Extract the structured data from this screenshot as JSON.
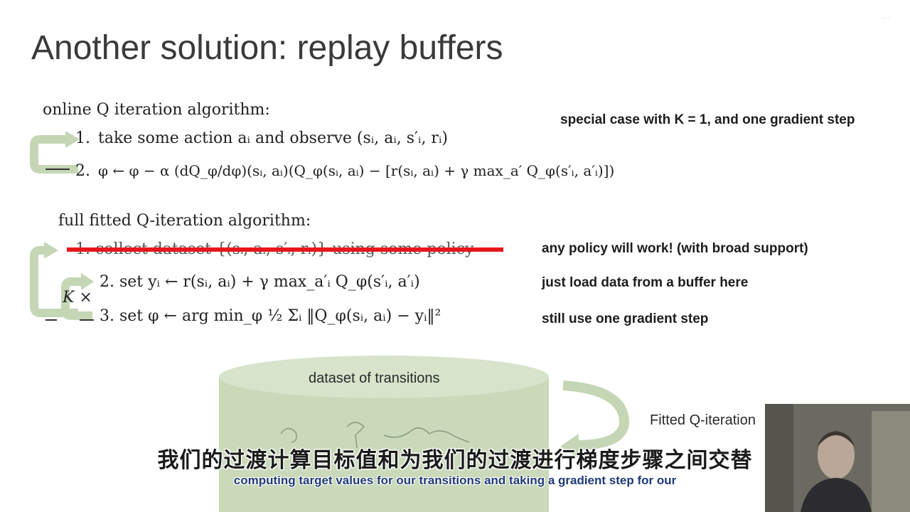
{
  "slide": {
    "title": "Another solution: replay buffers",
    "watermark": "…"
  },
  "online": {
    "heading": "online Q iteration algorithm:",
    "step1_num": "1.",
    "step1": "take some action aᵢ and observe (sᵢ, aᵢ, s′ᵢ, rᵢ)",
    "step2_num": "2.",
    "step2": "φ ← φ − α (dQ_φ/dφ)(sᵢ, aᵢ)(Q_φ(sᵢ, aᵢ) − [r(sᵢ, aᵢ) + γ max_a′ Q_φ(s′ᵢ, a′ᵢ)])",
    "note": "special case with K = 1, and one gradient step"
  },
  "fitted": {
    "heading": "full fitted Q-iteration algorithm:",
    "step1": "1. collect dataset {(sᵢ, aᵢ, s′ᵢ, rᵢ)} using some policy",
    "step2": "2. set yᵢ ← r(sᵢ, aᵢ) + γ max_a′ᵢ Q_φ(s′ᵢ, a′ᵢ)",
    "step3": "3. set φ ← arg min_φ ½ Σᵢ ‖Q_φ(sᵢ, aᵢ) − yᵢ‖²",
    "k_label": "K ×",
    "note1": "any policy will work! (with broad support)",
    "note2": "just load data from a buffer here",
    "note3": "still use one gradient step"
  },
  "diagram": {
    "buffer_label": "dataset of transitions",
    "arrow_label": "Fitted Q-iteration"
  },
  "subtitles": {
    "chinese": "我们的过渡计算目标值和为我们的过渡进行梯度步骤之间交替",
    "english": "computing target values for our transitions and taking a gradient step for our"
  },
  "colors": {
    "loop_arrow": "#c5d6b5",
    "cylinder": "#c9d9b9",
    "strike": "#e8161b",
    "subtitle_en": "#1f3b78"
  }
}
